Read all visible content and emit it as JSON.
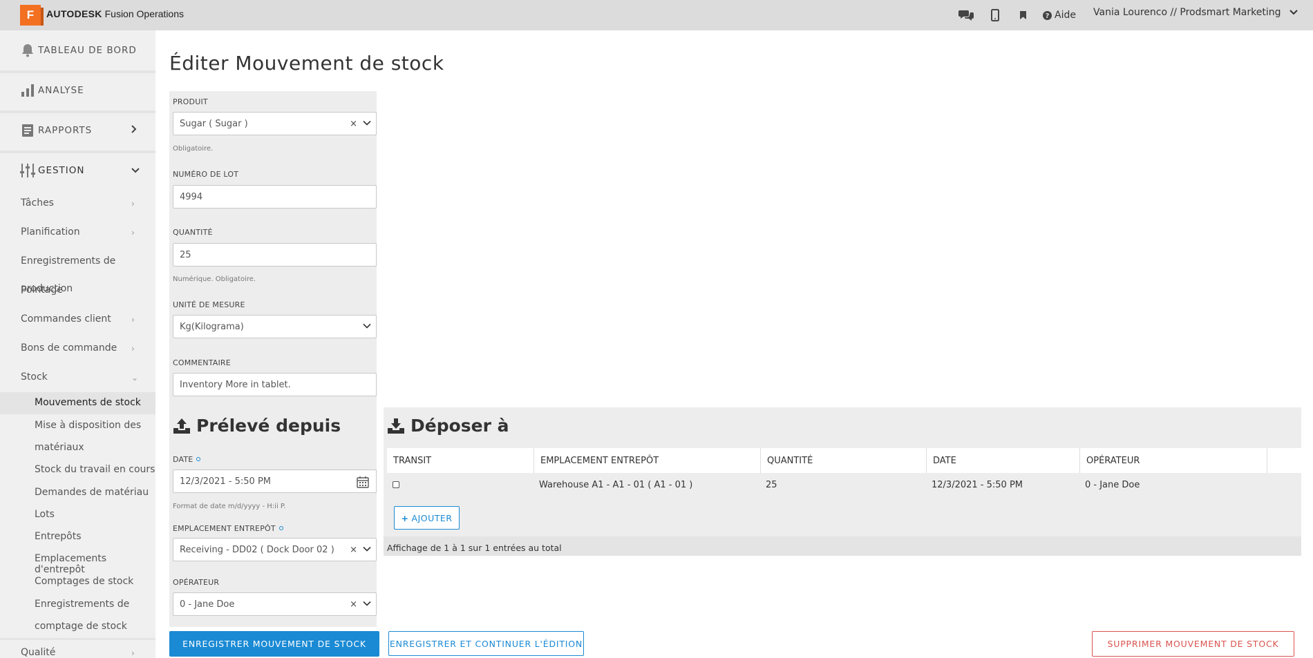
{
  "topbar": {
    "logo_letter": "F",
    "brand_bold": "AUTODESK",
    "brand_rest": " Fusion Operations",
    "help_label": "Aide",
    "user": "Vania Lourenco // Prodsmart Marketing",
    "icons": [
      "chat-icon",
      "mobile-icon",
      "bookmark-icon",
      "question-circle-icon"
    ]
  },
  "sidebar": {
    "main": [
      {
        "label": "TABLEAU DE BORD",
        "icon": "bell-icon"
      },
      {
        "label": "ANALYSE",
        "icon": "bar-chart-icon"
      },
      {
        "label": "RAPPORTS",
        "icon": "report-icon"
      },
      {
        "label": "GESTION",
        "icon": "sliders-icon"
      }
    ],
    "gestion_items": [
      "Tâches",
      "Planification",
      "Enregistrements de",
      "production",
      "Pointage",
      "Commandes client",
      "Bons de commande",
      "Stock"
    ],
    "stock_items": [
      "Mouvements de stock",
      "Mise à disposition des",
      "matériaux",
      "Stock du travail en cours",
      "Demandes de matériau",
      "Lots",
      "Entrepôts",
      "Emplacements d'entrepôt",
      "Comptages de stock",
      "Enregistrements de",
      "comptage de stock"
    ],
    "bottom_item": "Qualité"
  },
  "page": {
    "title": "Éditer Mouvement de stock"
  },
  "form": {
    "product": {
      "label": "PRODUIT",
      "value": "Sugar ( Sugar )",
      "help": "Obligatoire."
    },
    "lot": {
      "label": "NUMÉRO DE LOT",
      "value": "4994"
    },
    "quantity": {
      "label": "QUANTITÉ",
      "value": "25",
      "help": "Numérique. Obligatoire."
    },
    "unit": {
      "label": "UNITÉ DE MESURE",
      "value": "Kg(Kilograma)"
    },
    "comment": {
      "label": "COMMENTAIRE",
      "value": "Inventory More in tablet."
    }
  },
  "source": {
    "heading": "Prélevé depuis",
    "date": {
      "label": "DATE",
      "value": "12/3/2021 - 5:50 PM",
      "help": "Format de date m/d/yyyy - H:ii P."
    },
    "warehouse": {
      "label": "EMPLACEMENT ENTREPÔT",
      "value": "Receiving - DD02 ( Dock Door 02 )"
    },
    "operator": {
      "label": "OPÉRATEUR",
      "value": "0 - Jane Doe"
    }
  },
  "destination": {
    "heading": "Déposer à",
    "columns": [
      "TRANSIT",
      "EMPLACEMENT ENTREPÔT",
      "QUANTITÉ",
      "DATE",
      "OPÉRATEUR"
    ],
    "rows": [
      {
        "transit": false,
        "warehouse": "Warehouse A1 - A1 - 01 ( A1 - 01 )",
        "quantity": "25",
        "date": "12/3/2021 - 5:50 PM",
        "operator": "0 - Jane Doe"
      }
    ],
    "add_label": "AJOUTER",
    "footer": "Affichage de 1 à 1 sur 1 entrées au total"
  },
  "actions": {
    "save": "ENREGISTRER MOUVEMENT DE STOCK",
    "save_continue": "ENREGISTRER ET CONTINUER L'ÉDITION",
    "delete": "SUPPRIMER MOUVEMENT DE STOCK"
  },
  "colors": {
    "primary": "#1a8ad4",
    "danger": "#d9534f",
    "brand": "#f37021"
  }
}
